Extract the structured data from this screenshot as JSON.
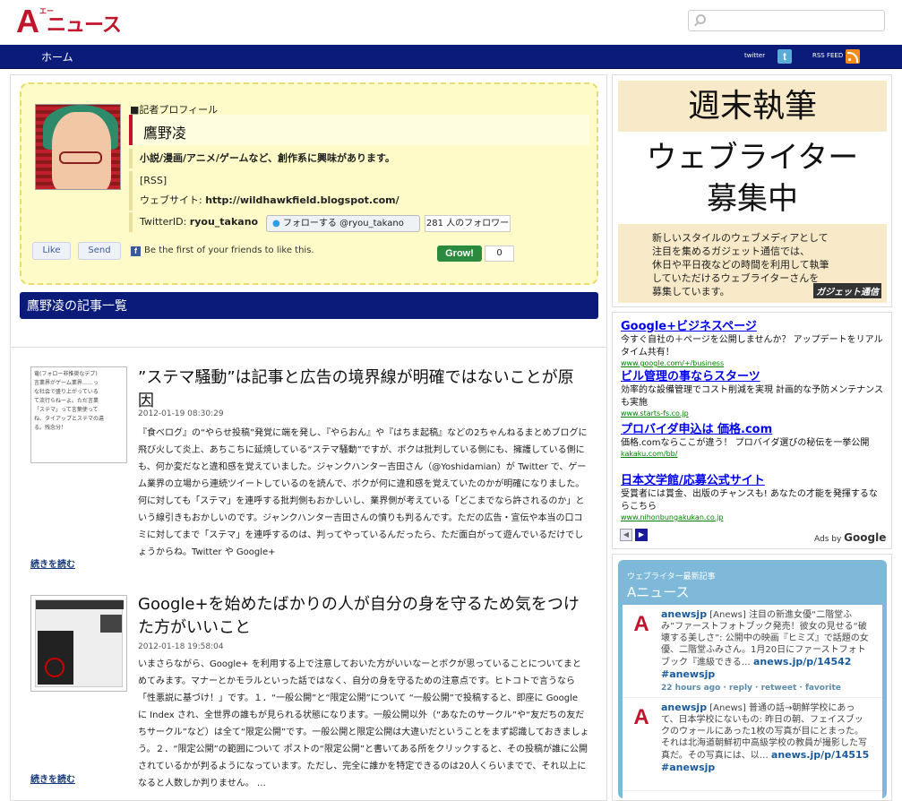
{
  "site": {
    "logo_letter": "A",
    "logo_sub": "エー",
    "logo_text": "ニュース"
  },
  "nav": {
    "home": "ホーム",
    "twitter": "twitter",
    "rss_feed": "RSS FEED"
  },
  "profile": {
    "heading": "■記者プロフィール",
    "name": "鷹野凌",
    "bio": "小説/漫画/アニメ/ゲームなど、創作系に興味があります。",
    "rss": "[RSS]",
    "website_label": "ウェブサイト: ",
    "website_url": "http://wildhawkfield.blogspot.com/",
    "twitter_label": "TwitterID: ",
    "twitter_id": "ryou_takano",
    "follow_button": "フォローする @ryou_takano",
    "follower_count": "281 人のフォロワー",
    "like": "Like",
    "send": "Send",
    "fb_text": "Be the first of your friends to like this.",
    "grow": "Grow!",
    "grow_count": "0"
  },
  "list_title": "鷹野凌の記事一覧",
  "articles": [
    {
      "title": "”ステマ騒動”は記事と広告の境界線が明確ではないことが原因",
      "date": "2012-01-19 08:30:29",
      "body": "『食べログ』の“やらせ投稿”発覚に端を発し、『やらおん』や『はちま起稿』などの2ちゃんねるまとめブログに飛び火して炎上、あちこちに延焼している“ステマ騒動”ですが、ボクは批判している側にも、擁護している側にも、何か変だなと違和感を覚えていました。ジャンクハンター吉田さん（@Yoshidamian）が Twitter で、ゲーム業界の立場から連続ツイートしているのを読んで、ボクが何に違和感を覚えていたのかが明確になりました。何に対しても「ステマ」を連呼する批判側もおかしいし、業界側が考えている「どこまでなら許されるのか」という線引きもおかしいのです。ジャンクハンター吉田さんの憤りも判るんです。ただの広告・宣伝や本当の口コミに対してまで「ステマ」を連呼するのは、判ってやっているんだったら、ただ面白がって遊んでいるだけでしょうからね。Twitter や Google+",
      "more": "続きを読む",
      "thumb_text": "竜(フォロー非推奨なデブ)\n言業界がゲーム業界……っ\nな社会で盛り上がっている\nて流行らねーよ。ただ言業\n「ステマ」って言葉使って\nね、タイアップとステマの違\nる。残念分！"
    },
    {
      "title": "Google+を始めたばかりの人が自分の身を守るため気をつけた方がいいこと",
      "date": "2012-01-18 19:58:04",
      "body": "いまさらながら、Google+ を利用する上で注意しておいた方がいいなーとボクが思っていることについてまとめてみます。マナーとかモラルといった話ではなく、自分の身を守るための注意点です。ヒトコトで言うなら「性悪説に基づけ！」です。１．“一般公開”と“限定公開”について “一般公開”で投稿すると、即座に Google に Index され、全世界の誰もが見られる状態になります。一般公開以外（“あなたのサークル”や“友だちの友だちサークル”など）は全て“限定公開”です。一般公開と限定公開は大違いだということをまず認識しておきましょう。２．“限定公開”の範囲について ポストの“限定公開”と書いてある所をクリックすると、その投稿が誰に公開されているかが判るようになっています。ただし、完全に誰かを特定できるのは20人くらいまでで、それ以上になると人数しか判りません。 …",
      "more": "続きを読む"
    }
  ],
  "ad_banner": {
    "top": "週末執筆",
    "middle_line1": "ウェブライター",
    "middle_line2": "募集中",
    "desc": "新しいスタイルのウェブメディアとして\n注目を集めるガジェット通信では、\n休日や平日夜などの時間を利用して執筆\nしていただけるウェブライターさんを\n募集しています。",
    "brand": "ガジェット通信"
  },
  "google_ads": [
    {
      "title": "Google+ビジネスページ",
      "desc": "今すぐ自社の＋ページを公開しませんか？ アップデートをリアルタイム共有！",
      "url": "www.google.com/+/business"
    },
    {
      "title": "ビル管理の事ならスターツ",
      "desc": "効率的な設備管理でコスト削減を実現 計画的な予防メンテナンスも実施",
      "url": "www.starts-fs.co.jp"
    },
    {
      "title": "プロバイダ申込は 価格.com",
      "desc": "価格.comならここが違う！ プロバイダ選びの秘伝を一挙公開",
      "url": "kakaku.com/bb/"
    },
    {
      "title": "日本文学館/応募公式サイト",
      "desc": "受賞者には賞金、出版のチャンスも! あなたの才能を発揮するならこちら",
      "url": "www.nihonbungakukan.co.jp"
    }
  ],
  "ads_by": {
    "prefix": "Ads by ",
    "brand": "Google"
  },
  "twitter_widget": {
    "subtitle": "ウェブライター最新記事",
    "title": "Aニュース",
    "tweets": [
      {
        "user": "anewsjp",
        "text": " [Anews] 注目の新進女優“二階堂ふみ”ファーストフォトブック発売！彼女の見せる“破壊する美しさ”: 公開中の映画『ヒミズ』で話題の女優、二階堂ふみさん。1月20日にファーストフォトブック『進級できる…",
        "link": "anews.jp/p/14542",
        "tag": "#anewsjp",
        "meta": "22 hours ago · reply · retweet · favorite"
      },
      {
        "user": "anewsjp",
        "text": " [Anews] 普通の話→朝鮮学校にあって、日本学校にないもの: 昨日の朝、フェイスブックのウォールにあった1枚の写真が目にとまった。それは北海道朝鮮初中高級学校の教員が撮影した写真だ。その写真には、以…",
        "link": "anews.jp/p/14515",
        "tag": "#anewsjp",
        "meta": ""
      }
    ]
  },
  "colors": {
    "nav": "#0b1b7a",
    "profile_bg": "#fffbc8",
    "accent": "#c0152b",
    "twitter_box": "#7fb9d9"
  }
}
